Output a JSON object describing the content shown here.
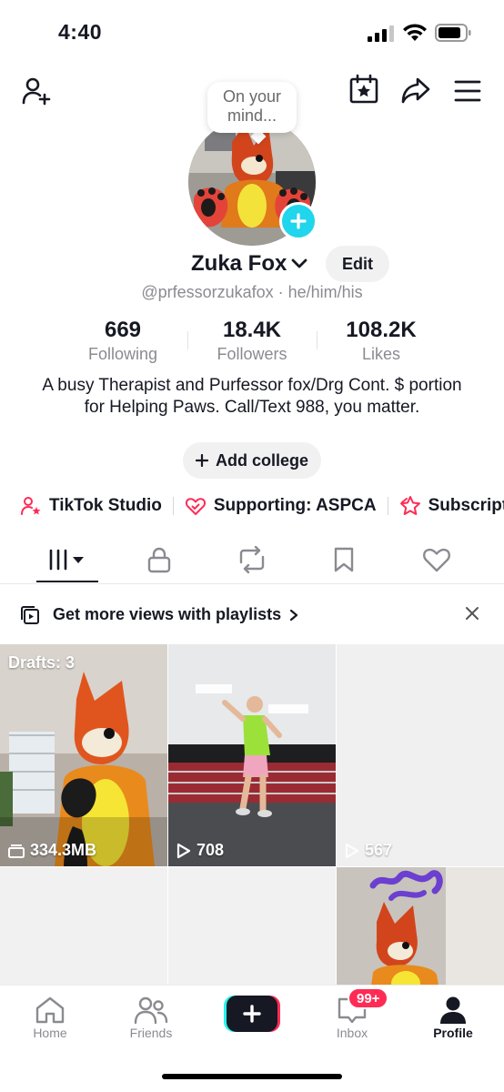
{
  "status_bar": {
    "time": "4:40"
  },
  "avatar": {
    "thought_bubble": "On your mind..."
  },
  "profile": {
    "display_name": "Zuka Fox",
    "edit_label": "Edit",
    "handle": "@prfessorzukafox · he/him/his",
    "stats": [
      {
        "value": "669",
        "label": "Following"
      },
      {
        "value": "18.4K",
        "label": "Followers"
      },
      {
        "value": "108.2K",
        "label": "Likes"
      }
    ],
    "bio": "A busy Therapist and Purfessor fox/Drg Cont. $ portion for Helping Paws. Call/Text 988, you matter.",
    "add_college_label": "Add college"
  },
  "links": [
    {
      "label": "TikTok Studio",
      "icon": "studio-person-icon"
    },
    {
      "label": "Supporting: ASPCA",
      "icon": "heart-hands-icon"
    },
    {
      "label": "Subscript",
      "icon": "star-badge-icon"
    }
  ],
  "tabs": [
    {
      "name": "videos",
      "icon": "grid-bars-icon",
      "active": true
    },
    {
      "name": "private",
      "icon": "lock-icon"
    },
    {
      "name": "reposts",
      "icon": "repost-icon"
    },
    {
      "name": "favorites",
      "icon": "bookmark-icon"
    },
    {
      "name": "liked",
      "icon": "heart-outline-icon"
    }
  ],
  "banner": {
    "text": "Get more views with playlists"
  },
  "grid": {
    "drafts_label": "Drafts: 3",
    "items": [
      {
        "label": "334.3MB",
        "icon": "drafts-stack-icon"
      },
      {
        "label": "708",
        "icon": "play-icon"
      },
      {
        "label": "567",
        "icon": "play-icon"
      }
    ]
  },
  "bottom_nav": {
    "items": [
      {
        "label": "Home",
        "icon": "home-icon"
      },
      {
        "label": "Friends",
        "icon": "friends-icon"
      },
      {
        "label": "",
        "icon": "create-plus-icon"
      },
      {
        "label": "Inbox",
        "icon": "inbox-icon"
      },
      {
        "label": "Profile",
        "icon": "profile-icon"
      }
    ],
    "inbox_badge": "99+"
  },
  "colors": {
    "accent_cyan": "#20d5ec",
    "accent_pink": "#fe2c55",
    "text_primary": "#161823",
    "text_secondary": "#8a8b91"
  }
}
